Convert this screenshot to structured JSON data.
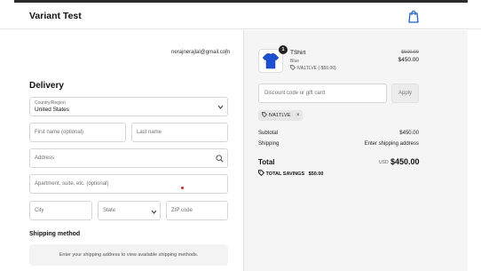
{
  "header": {
    "store_name": "Variant Test",
    "cart_icon": "shopping-bag-icon"
  },
  "account": {
    "email": "nerajnerajlal@gmail.com",
    "menu_icon": "kebab-menu-icon"
  },
  "delivery": {
    "heading": "Delivery",
    "country_label": "Country/Region",
    "country_value": "United States",
    "first_name_placeholder": "First name (optional)",
    "last_name_placeholder": "Last name",
    "address_placeholder": "Address",
    "apartment_placeholder": "Apartment, suite, etc. (optional)",
    "city_placeholder": "City",
    "state_placeholder": "State",
    "zip_placeholder": "ZIP code"
  },
  "shipping": {
    "heading": "Shipping method",
    "message": "Enter your shipping address to view available shipping methods."
  },
  "order": {
    "product": {
      "name": "TShirt",
      "variant": "Blue",
      "discount_line": "IVA1TLVE (-$50.00)",
      "quantity": "1",
      "old_price": "$500.00",
      "price": "$450.00",
      "color": "#1f4fd1"
    },
    "discount_placeholder": "Discount code or gift card",
    "apply_label": "Apply",
    "applied_code": "IVA1TLVE",
    "remove_icon": "×",
    "subtotal_label": "Subtotal",
    "subtotal_value": "$450.00",
    "shipping_label": "Shipping",
    "shipping_value": "Enter shipping address",
    "total_label": "Total",
    "currency": "USD",
    "total_value": "$450.00",
    "savings_label": "TOTAL SAVINGS",
    "savings_value": "$50.00"
  }
}
